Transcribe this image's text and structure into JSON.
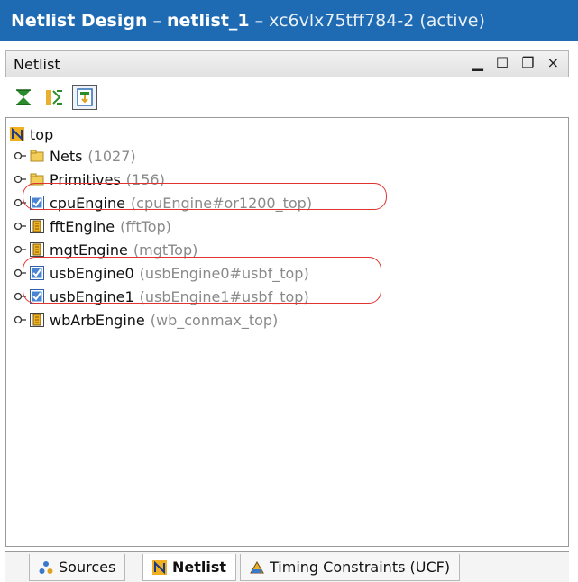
{
  "title": {
    "main": "Netlist Design",
    "separator": "–",
    "design": "netlist_1",
    "device": "xc6vlx75tff784-2 (active)"
  },
  "panel": {
    "label": "Netlist",
    "controls": {
      "minimize": "▁",
      "maximize": "☐",
      "restore": "❐",
      "close": "×"
    }
  },
  "toolbar": {
    "buttons": [
      {
        "icon": "collapse-all-icon"
      },
      {
        "icon": "expand-icon"
      },
      {
        "icon": "auto-select-icon",
        "active": true
      }
    ]
  },
  "tree": {
    "root": {
      "name": "top",
      "icon": "netlist-icon"
    },
    "items": [
      {
        "name": "Nets",
        "detail": "(1027)",
        "icon": "folder-icon"
      },
      {
        "name": "Primitives",
        "detail": "(156)",
        "icon": "folder-icon"
      },
      {
        "name": "cpuEngine",
        "detail": "(cpuEngine#or1200_top)",
        "icon": "checked-module-icon"
      },
      {
        "name": "fftEngine",
        "detail": "(fftTop)",
        "icon": "module-icon"
      },
      {
        "name": "mgtEngine",
        "detail": "(mgtTop)",
        "icon": "module-icon"
      },
      {
        "name": "usbEngine0",
        "detail": "(usbEngine0#usbf_top)",
        "icon": "checked-module-icon"
      },
      {
        "name": "usbEngine1",
        "detail": "(usbEngine1#usbf_top)",
        "icon": "checked-module-icon"
      },
      {
        "name": "wbArbEngine",
        "detail": "(wb_conmax_top)",
        "icon": "module-icon"
      }
    ]
  },
  "tabs": [
    {
      "label": "Sources",
      "icon": "sources-icon"
    },
    {
      "label": "Netlist",
      "icon": "netlist-icon",
      "active": true
    },
    {
      "label": "Timing Constraints (UCF)",
      "icon": "timing-icon"
    }
  ],
  "colors": {
    "titlebar": "#1e6bb4",
    "highlight": "#e0342f",
    "detail_text": "#8a8a8a"
  }
}
